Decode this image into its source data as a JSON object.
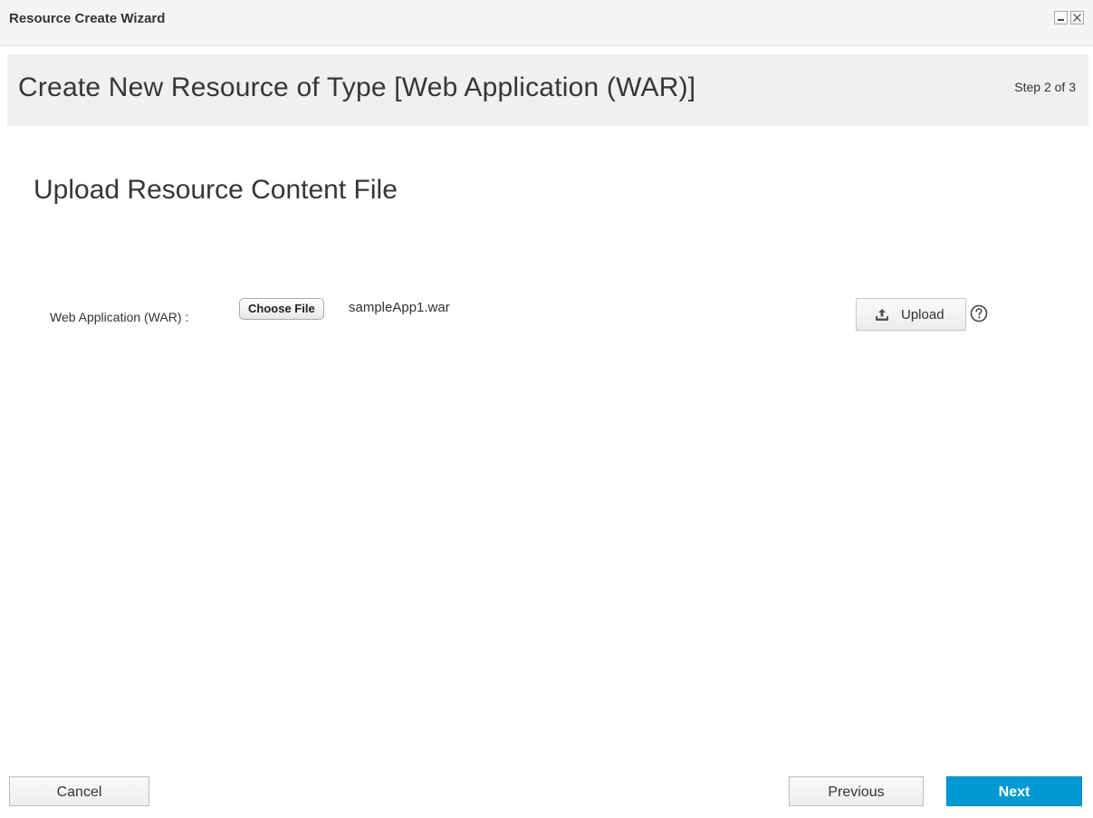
{
  "window": {
    "title": "Resource Create Wizard",
    "controls": {
      "minimize_icon": "minimize-icon",
      "close_icon": "close-icon"
    }
  },
  "header": {
    "title": "Create New Resource of Type [Web Application (WAR)]",
    "step": "Step 2 of 3"
  },
  "section": {
    "title": "Upload Resource Content File"
  },
  "form": {
    "field_label": "Web Application (WAR) :",
    "choose_file_label": "Choose File",
    "selected_file": "sampleApp1.war",
    "upload_label": "Upload",
    "upload_icon": "upload-icon",
    "help_icon": "help-icon"
  },
  "footer": {
    "cancel_label": "Cancel",
    "previous_label": "Previous",
    "next_label": "Next"
  },
  "colors": {
    "primary": "#0099d3",
    "header_band": "#f0f0f0",
    "titlebar": "#f5f5f5"
  }
}
